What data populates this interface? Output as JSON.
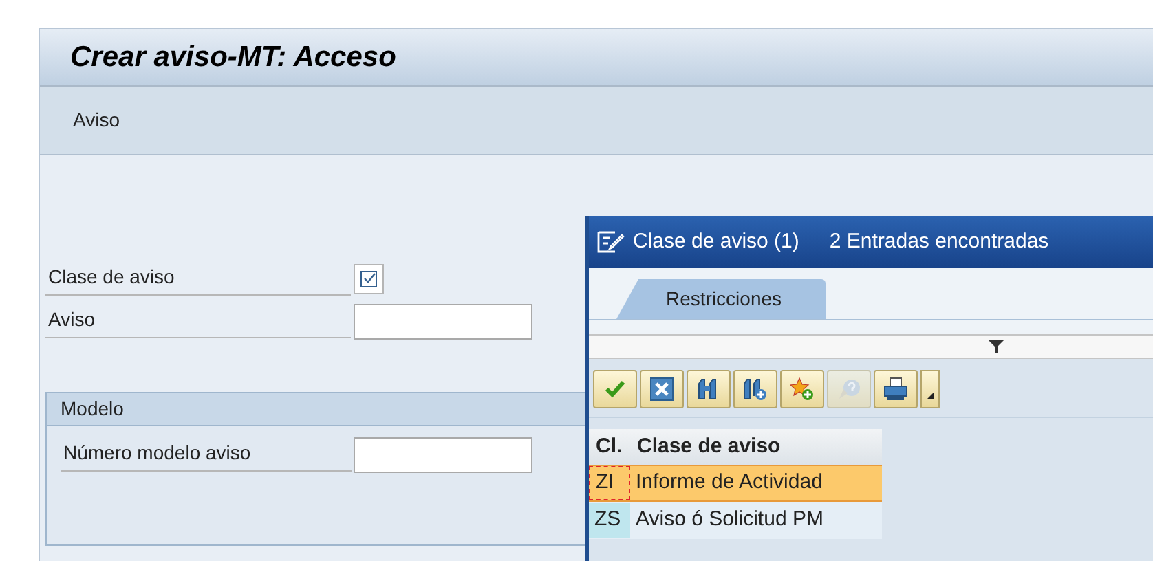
{
  "window": {
    "title": "Crear aviso-MT: Acceso"
  },
  "menu_bar": [
    "Aviso"
  ],
  "fields": [
    {
      "label": "Clase de aviso",
      "kind": "f4"
    },
    {
      "label": "Aviso",
      "kind": "input"
    }
  ],
  "group": {
    "title": "Modelo",
    "fields": [
      {
        "label": "Número modelo aviso",
        "kind": "input"
      }
    ]
  },
  "popup": {
    "title": "Clase de aviso (1)",
    "count": "2 Entradas encontradas",
    "tabs": [
      {
        "label": "Restricciones",
        "selected": true
      }
    ],
    "toolbar": [
      {
        "kind": "check",
        "disabled": false
      },
      {
        "kind": "cancel",
        "disabled": false
      },
      {
        "kind": "find",
        "disabled": false
      },
      {
        "kind": "find-next",
        "disabled": false
      },
      {
        "kind": "favorite",
        "disabled": false
      },
      {
        "kind": "help",
        "disabled": true
      },
      {
        "kind": "print",
        "disabled": false
      }
    ],
    "columns": [
      "Cl.",
      "Clase de aviso"
    ],
    "rows": [
      {
        "cells": [
          "ZI",
          "Informe de Actividad"
        ],
        "selected": true
      },
      {
        "cells": [
          "ZS",
          "Aviso ó Solicitud PM"
        ],
        "selected": false
      }
    ]
  }
}
